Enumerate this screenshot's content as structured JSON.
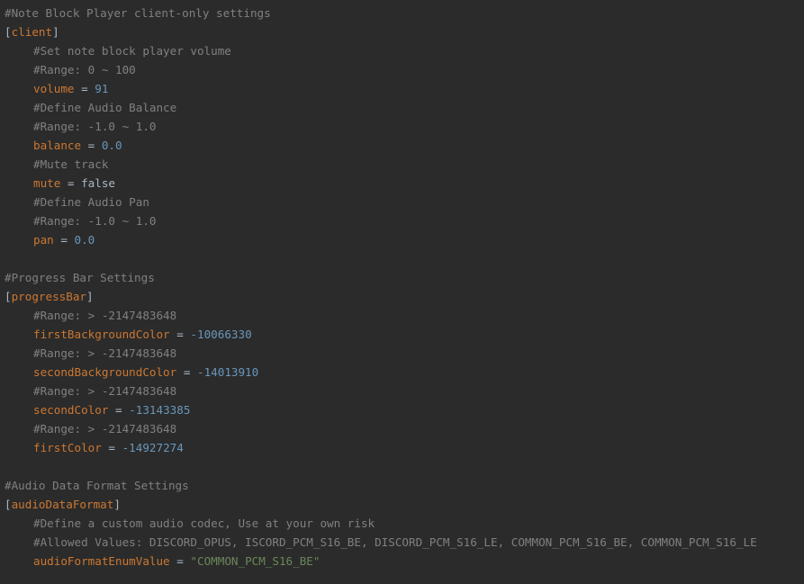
{
  "client_section": {
    "header_comment": "#Note Block Player client-only settings",
    "name": "client",
    "entries": [
      {
        "comment": "#Set note block player volume"
      },
      {
        "comment": "#Range: 0 ~ 100"
      },
      {
        "key": "volume",
        "value": "91",
        "type": "num"
      },
      {
        "comment": "#Define Audio Balance"
      },
      {
        "comment": "#Range: -1.0 ~ 1.0"
      },
      {
        "key": "balance",
        "value": "0.0",
        "type": "num"
      },
      {
        "comment": "#Mute track"
      },
      {
        "key": "mute",
        "value": "false",
        "type": "bool"
      },
      {
        "comment": "#Define Audio Pan"
      },
      {
        "comment": "#Range: -1.0 ~ 1.0"
      },
      {
        "key": "pan",
        "value": "0.0",
        "type": "num"
      }
    ]
  },
  "progress_section": {
    "header_comment": "#Progress Bar Settings",
    "name": "progressBar",
    "entries": [
      {
        "comment": "#Range: > -2147483648"
      },
      {
        "key": "firstBackgroundColor",
        "value": "-10066330",
        "type": "num"
      },
      {
        "comment": "#Range: > -2147483648"
      },
      {
        "key": "secondBackgroundColor",
        "value": "-14013910",
        "type": "num"
      },
      {
        "comment": "#Range: > -2147483648"
      },
      {
        "key": "secondColor",
        "value": "-13143385",
        "type": "num"
      },
      {
        "comment": "#Range: > -2147483648"
      },
      {
        "key": "firstColor",
        "value": "-14927274",
        "type": "num"
      }
    ]
  },
  "audio_section": {
    "header_comment": "#Audio Data Format Settings",
    "name": "audioDataFormat",
    "entries": [
      {
        "comment": "#Define a custom audio codec, Use at your own risk"
      },
      {
        "comment": "#Allowed Values: DISCORD_OPUS, ISCORD_PCM_S16_BE, DISCORD_PCM_S16_LE, COMMON_PCM_S16_BE, COMMON_PCM_S16_LE"
      },
      {
        "key": "audioFormatEnumValue",
        "value": "\"COMMON_PCM_S16_BE\"",
        "type": "str"
      }
    ]
  },
  "theme": {
    "background": "#2b2b2b",
    "comment": "#808080",
    "keyword": "#cc7832",
    "number": "#6897bb",
    "string": "#6a8759",
    "text": "#a9b7c6"
  }
}
